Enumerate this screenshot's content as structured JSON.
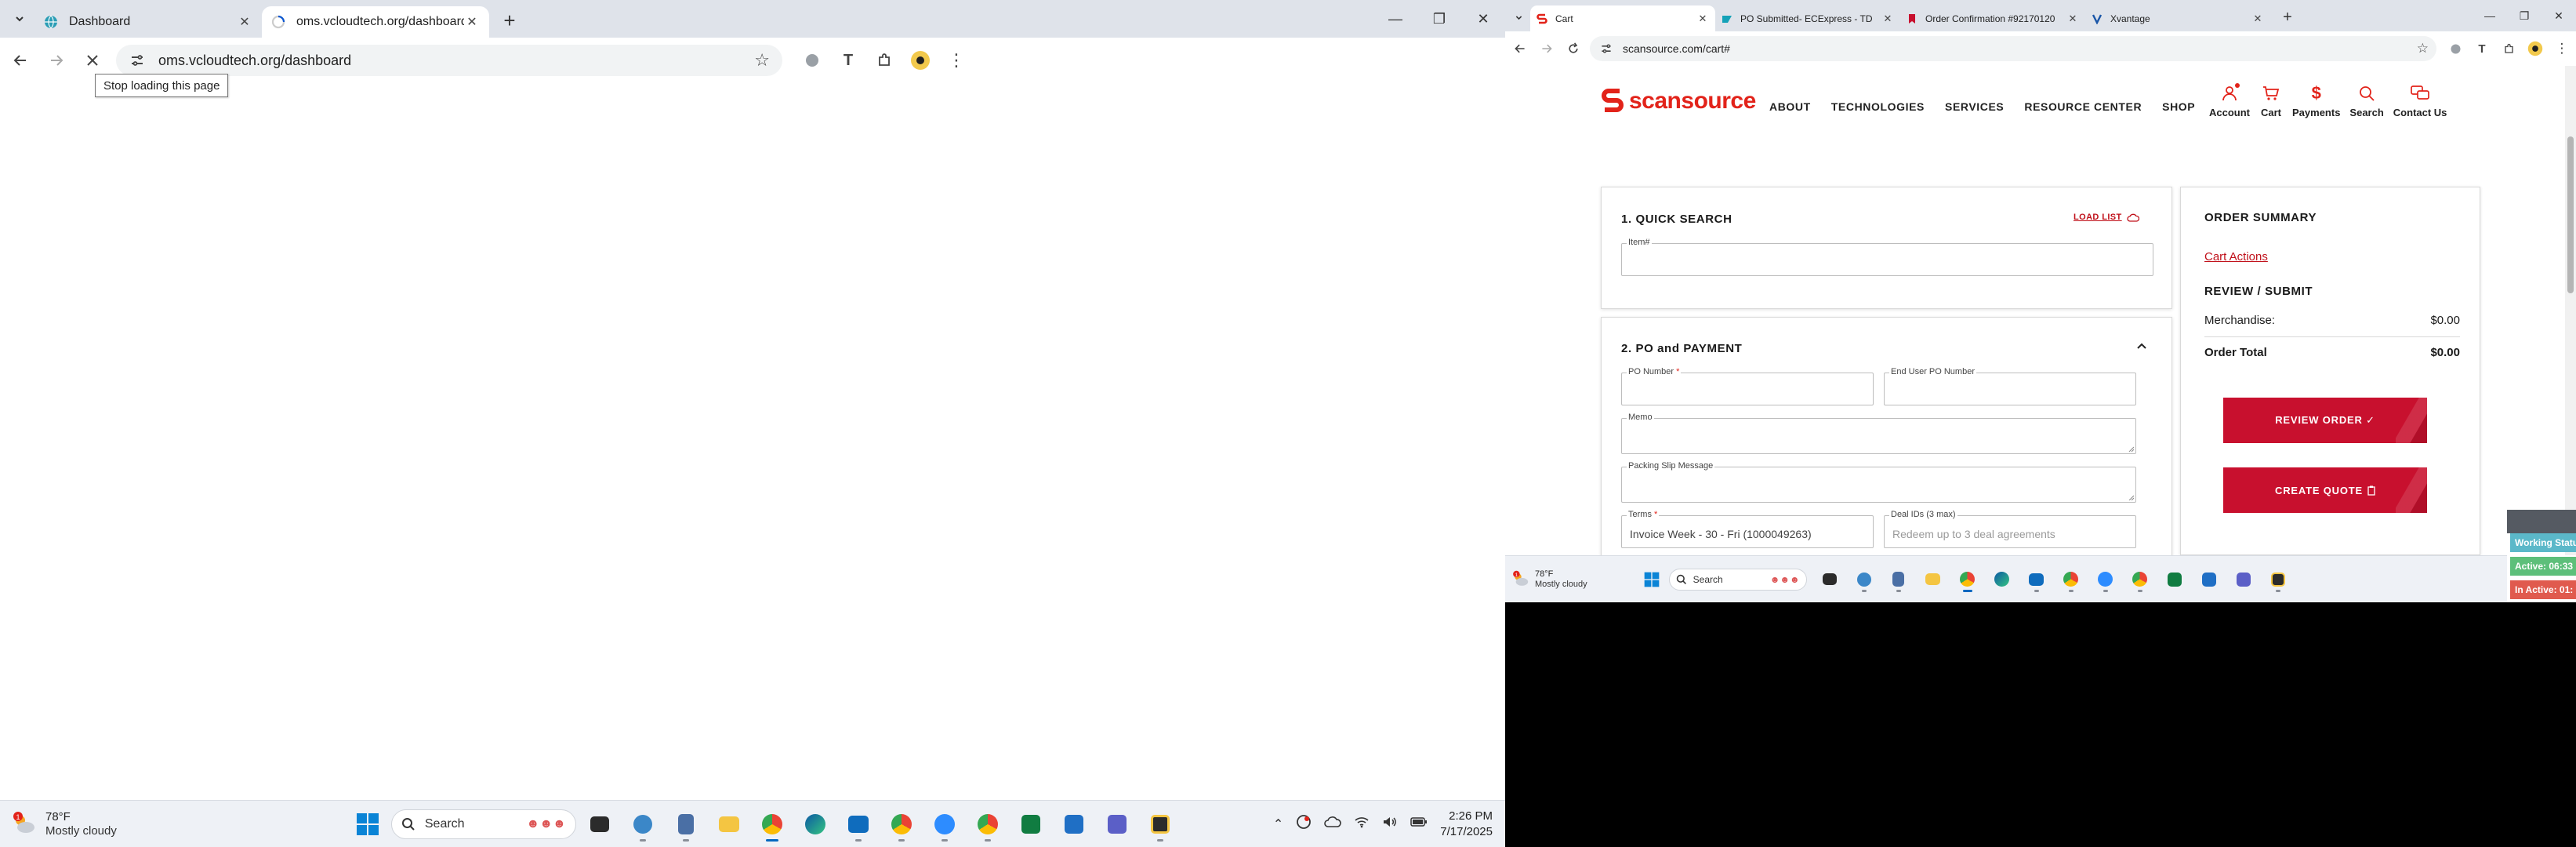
{
  "left_browser": {
    "tabs": [
      {
        "title": "Dashboard",
        "active": false
      },
      {
        "title": "oms.vcloudtech.org/dashboard",
        "active": true
      }
    ],
    "url": "oms.vcloudtech.org/dashboard",
    "tooltip": "Stop loading this page"
  },
  "left_taskbar": {
    "weather_badge": "1",
    "temperature": "78°F",
    "condition": "Mostly cloudy",
    "search_label": "Search",
    "time": "2:26 PM",
    "date": "7/17/2025"
  },
  "right_browser": {
    "tabs": [
      {
        "title": "Cart",
        "active": true
      },
      {
        "title": "PO Submitted- ECExpress - TD",
        "active": false
      },
      {
        "title": "Order Confirmation #92170120",
        "active": false
      },
      {
        "title": "Xvantage",
        "active": false
      }
    ],
    "url": "scansource.com/cart#"
  },
  "site": {
    "logo_text": "scansource",
    "nav": [
      "ABOUT",
      "TECHNOLOGIES",
      "SERVICES",
      "RESOURCE CENTER",
      "SHOP"
    ],
    "util": [
      "Account",
      "Cart",
      "Payments",
      "Search",
      "Contact Us"
    ],
    "quick_search": {
      "title": "1. QUICK SEARCH",
      "load_list": "LOAD LIST",
      "item_label": "Item#"
    },
    "po_payment": {
      "title": "2. PO and PAYMENT",
      "po_number_label": "PO Number",
      "end_user_po_label": "End User PO Number",
      "memo_label": "Memo",
      "packing_slip_label": "Packing Slip Message",
      "terms_label": "Terms",
      "terms_value": "Invoice Week - 30 - Fri (1000049263)",
      "deal_ids_label": "Deal IDs (3 max)",
      "deal_ids_placeholder": "Redeem up to 3 deal agreements"
    },
    "summary": {
      "title": "ORDER SUMMARY",
      "cart_actions": "Cart Actions",
      "review_submit": "REVIEW / SUBMIT",
      "merchandise_label": "Merchandise:",
      "merchandise_value": "$0.00",
      "total_label": "Order Total",
      "total_value": "$0.00",
      "review_button": "REVIEW ORDER ✓",
      "quote_button": "CREATE QUOTE"
    }
  },
  "status_widget": {
    "working": "Working Status",
    "active": "Active: 06:33",
    "inactive": "In Active: 01:"
  },
  "right_taskbar": {
    "weather_badge": "1",
    "temperature": "78°F",
    "condition": "Mostly cloudy",
    "search_label": "Search"
  },
  "colors": {
    "brand_red": "#c8102e",
    "link_red": "#c0101a"
  }
}
